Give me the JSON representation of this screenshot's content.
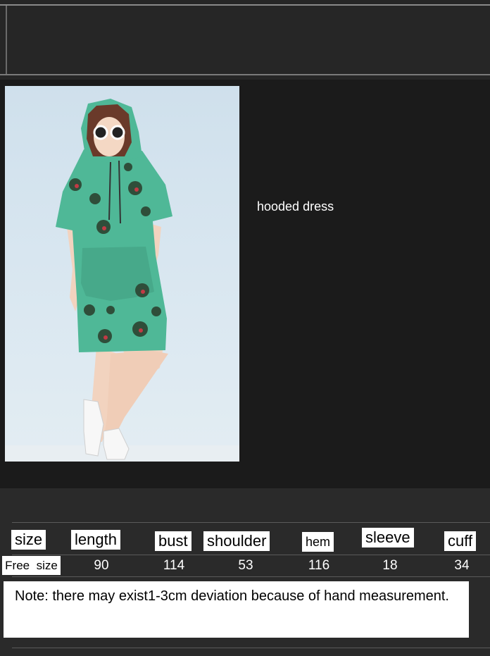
{
  "product": {
    "caption": "hooded dress",
    "photo_icon": "model-photo"
  },
  "size_table": {
    "headers": [
      "size",
      "length",
      "bust",
      "shoulder",
      "hem",
      "sleeve",
      "cuff"
    ],
    "row": {
      "size": "Free  size",
      "values": [
        "90",
        "114",
        "53",
        "116",
        "18",
        "34"
      ]
    }
  },
  "note": "Note: there may exist1-3cm deviation because of hand measurement.",
  "colors": {
    "background": "#141414",
    "dress": "#4fb897",
    "text": "#ffffff"
  }
}
